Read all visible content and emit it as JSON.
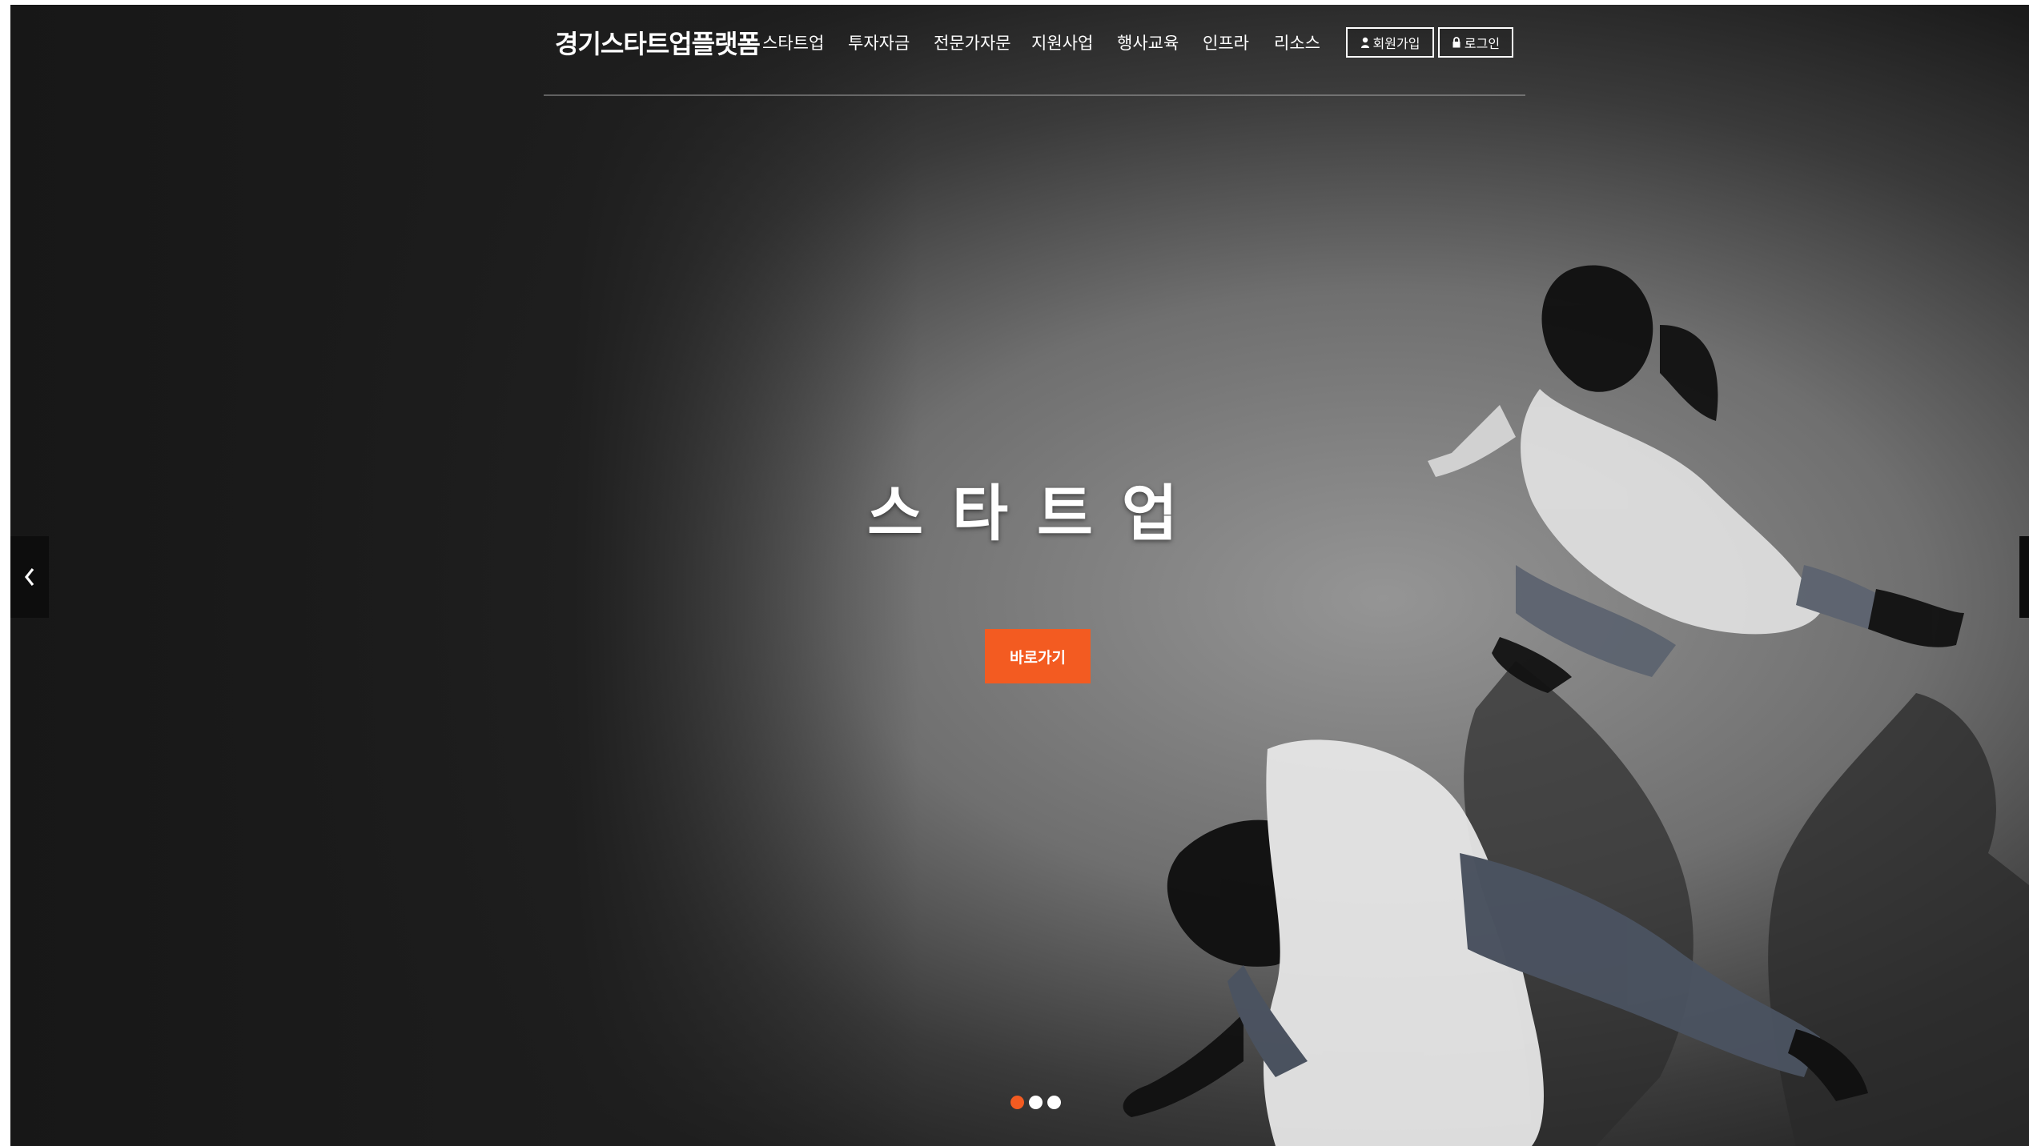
{
  "header": {
    "logo": "경기스타트업플랫폼",
    "nav": [
      {
        "label": "스타트업"
      },
      {
        "label": "투자자금"
      },
      {
        "label": "전문가자문"
      },
      {
        "label": "지원사업"
      },
      {
        "label": "행사교육"
      },
      {
        "label": "인프라"
      },
      {
        "label": "리소스"
      }
    ],
    "signup_label": "회원가입",
    "login_label": "로그인"
  },
  "hero": {
    "title": "스타트업",
    "cta_label": "바로가기",
    "slides_count": 3,
    "active_slide": 1
  },
  "colors": {
    "accent": "#f35b21",
    "text": "#ffffff"
  },
  "icons": {
    "prev": "chevron-left-icon",
    "signup": "user-icon",
    "login": "lock-icon"
  }
}
